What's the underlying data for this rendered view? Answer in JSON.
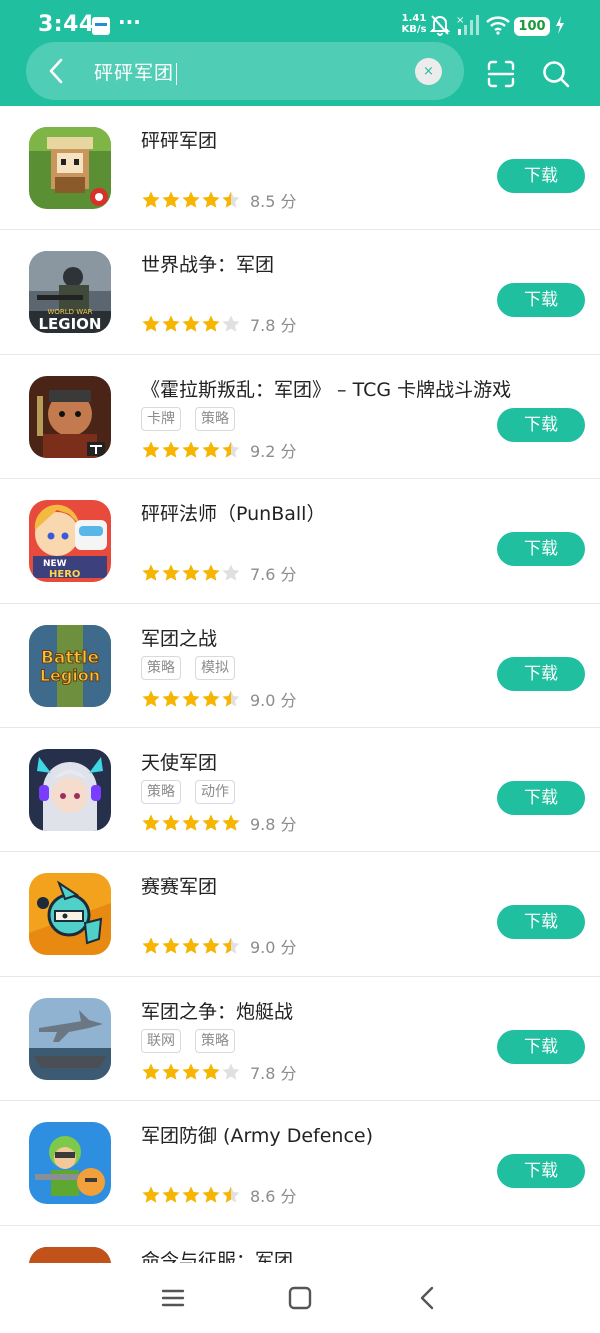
{
  "status_bar": {
    "time": "3:44",
    "more": "···",
    "net_speed_value": "1.41",
    "net_speed_unit": "KB/s",
    "battery": "100"
  },
  "search": {
    "query": "砰砰军团",
    "clear_symbol": "×"
  },
  "results": [
    {
      "name": "砰砰军团",
      "tags": [],
      "stars": 4.5,
      "score": "8.5 分",
      "button": "下载",
      "icon": "pixel-knight-icon"
    },
    {
      "name": "世界战争：军团",
      "tags": [],
      "stars": 4,
      "score": "7.8 分",
      "button": "下载",
      "icon": "world-war-legion-icon",
      "icon_text_small": "WORLD WAR",
      "icon_text_big": "LEGION"
    },
    {
      "name": "《霍拉斯叛乱：军团》 – TCG 卡牌战斗游戏",
      "tags": [
        "卡牌",
        "策略"
      ],
      "stars": 4.5,
      "score": "9.2 分",
      "button": "下载",
      "icon": "warrior-portrait-icon"
    },
    {
      "name": "砰砰法师（PunBall）",
      "tags": [],
      "stars": 4,
      "score": "7.6 分",
      "button": "下载",
      "icon": "new-hero-icon",
      "icon_text_1": "NEW",
      "icon_text_2": "HERO"
    },
    {
      "name": "军团之战",
      "tags": [
        "策略",
        "模拟"
      ],
      "stars": 4.5,
      "score": "9.0 分",
      "button": "下载",
      "icon": "battle-legion-icon",
      "icon_text_1": "Battle",
      "icon_text_2": "Legion"
    },
    {
      "name": "天使军团",
      "tags": [
        "策略",
        "动作"
      ],
      "stars": 5,
      "score": "9.8 分",
      "button": "下载",
      "icon": "anime-girl-icon"
    },
    {
      "name": "赛赛军团",
      "tags": [],
      "stars": 4.5,
      "score": "9.0 分",
      "button": "下载",
      "icon": "cartoon-knight-icon"
    },
    {
      "name": "军团之争：炮艇战",
      "tags": [
        "联网",
        "策略"
      ],
      "stars": 4,
      "score": "7.8 分",
      "button": "下载",
      "icon": "jet-carrier-icon"
    },
    {
      "name": "军团防御 (Army Defence)",
      "tags": [],
      "stars": 4.5,
      "score": "8.6 分",
      "button": "下载",
      "icon": "soldier-cartoon-icon"
    },
    {
      "name": "命令与征服：军团",
      "tags": [],
      "stars": 0,
      "score": "",
      "button": "",
      "icon": "command-conquer-icon"
    }
  ],
  "colors": {
    "accent": "#1fbfa0",
    "star": "#f7b500",
    "star_empty": "#e0e0e0"
  },
  "nav": [
    "menu-icon",
    "home-icon",
    "back-icon"
  ]
}
